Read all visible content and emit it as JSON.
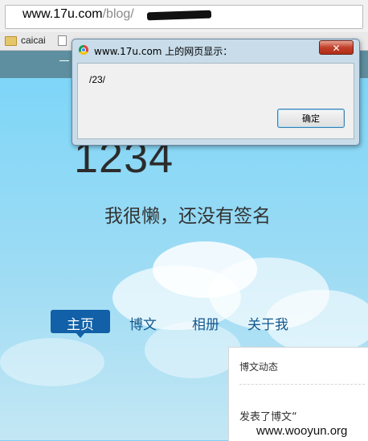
{
  "browser": {
    "url_host": "www.17u.com",
    "url_path": "/blog/",
    "bookmark_folder_label": "caicai",
    "bookmark_more_label": "»"
  },
  "blog": {
    "title": "1234",
    "signature": "我很懒，还没有签名",
    "menu": [
      {
        "label": "主页",
        "active": true
      },
      {
        "label": "博文",
        "active": false
      },
      {
        "label": "相册",
        "active": false
      },
      {
        "label": "关于我",
        "active": false
      }
    ],
    "sidebar": {
      "heading": "博文动态",
      "entry_text": "发表了博文“"
    }
  },
  "dialog": {
    "title": "www.17u.com 上的网页显示：",
    "message": "/23/",
    "ok_label": "确定",
    "close_glyph": "✕"
  },
  "watermark": "www.wooyun.org",
  "colors": {
    "sky": "#7ed6f8",
    "menu_active_bg": "#1160a8",
    "menu_text": "#11588e",
    "dialog_frame": "#c8dcea",
    "close_button": "#c2402a"
  },
  "icons": {
    "folder": "folder-icon",
    "page": "page-icon",
    "browser_logo": "chrome-icon"
  }
}
